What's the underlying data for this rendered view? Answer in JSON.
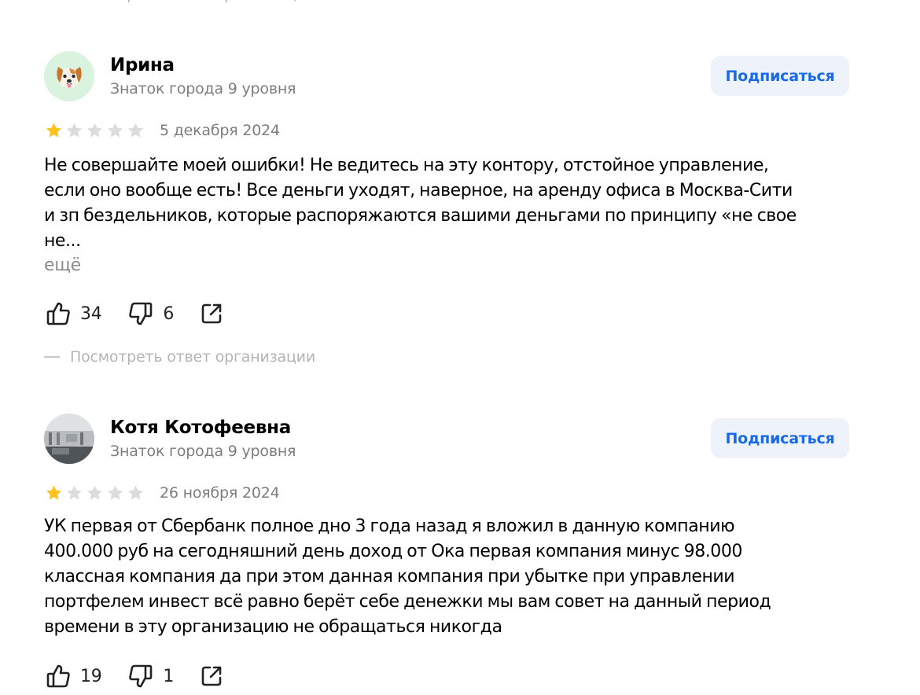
{
  "reply_link": "Посмотреть ответ организации",
  "reviews": [
    {
      "author": "Ирина",
      "status": "Знаток города 9 уровня",
      "subscribe": "Подписаться",
      "rating": 1,
      "date": "5 декабря 2024",
      "text_lines": [
        "Не совершайте моей ошибки! Не ведитесь на эту контору, отстойное управление,",
        "если оно вообще есть! Все деньги уходят, наверное, на аренду офиса в Москва-Сити",
        "и зп бездельников, которые распоряжаются вашими деньгами по принципу «не свое",
        "не..."
      ],
      "more": "ещё",
      "likes": "34",
      "dislikes": "6",
      "avatar_icon": "dog-face-icon"
    },
    {
      "author": "Котя Котофеевна",
      "status": "Знаток города 9 уровня",
      "subscribe": "Подписаться",
      "rating": 1,
      "date": "26 ноября 2024",
      "text_lines": [
        "УК первая от Сбербанк полное дно 3 года назад я вложил в данную компанию",
        "400.000 руб на сегодняшний день доход от Ока первая компания минус 98.000",
        "классная компания да при этом данная компания при убытке при управлении",
        "портфелем инвест всё равно берёт себе денежки мы вам совет на данный период",
        "времени в эту организацию не обращаться никогда"
      ],
      "likes": "19",
      "dislikes": "1",
      "avatar_icon": "photo-avatar"
    }
  ],
  "colors": {
    "star_filled": "#fcc31e",
    "star_empty": "#dcdcdc",
    "subscribe_bg": "#eef3fb",
    "subscribe_text": "#1a6ae8",
    "avatar_dog_bg": "#daf3de"
  }
}
